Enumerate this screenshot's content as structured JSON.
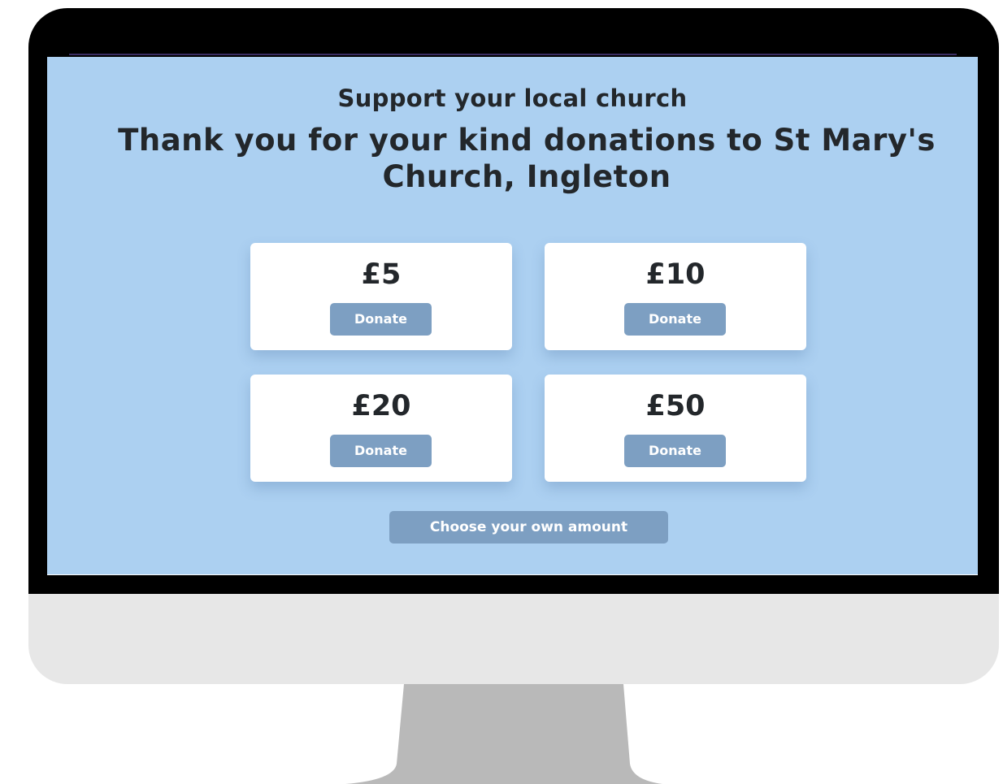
{
  "page": {
    "subtitle": "Support your local church",
    "title": "Thank you for your kind donations to St Mary's Church, Ingleton"
  },
  "donation_options": [
    {
      "amount": "£5",
      "button_label": "Donate"
    },
    {
      "amount": "£10",
      "button_label": "Donate"
    },
    {
      "amount": "£20",
      "button_label": "Donate"
    },
    {
      "amount": "£50",
      "button_label": "Donate"
    }
  ],
  "custom_amount": {
    "button_label": "Choose your own amount"
  },
  "colors": {
    "screen_background": "#acd0f1",
    "button_background": "#7d9fc2",
    "text": "#23272b",
    "card_background": "#ffffff",
    "monitor_bezel": "#000000",
    "monitor_chin": "#e7e7e7",
    "monitor_stand": "#b9b9b9"
  }
}
